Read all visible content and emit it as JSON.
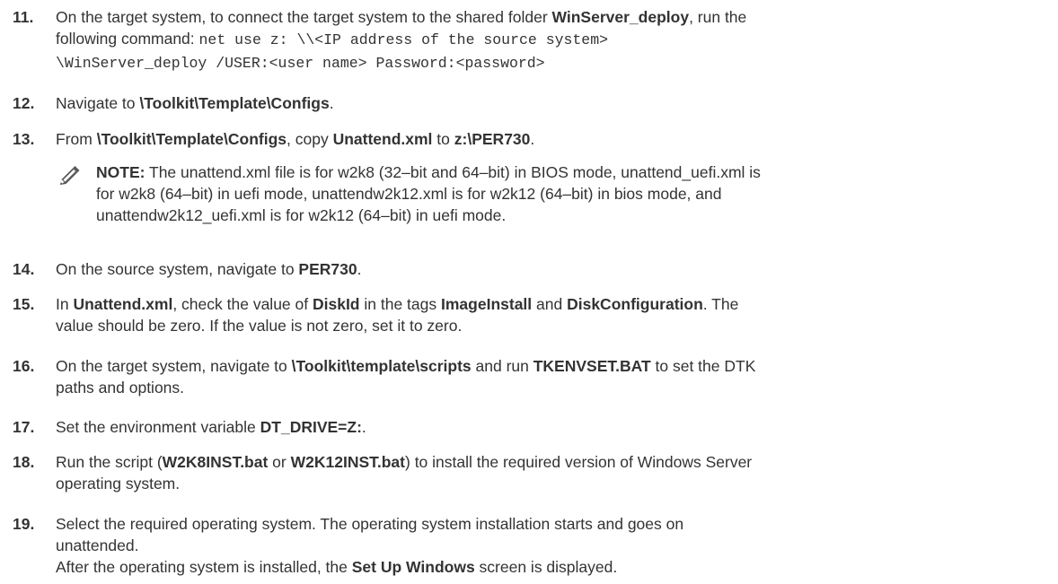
{
  "steps": [
    {
      "num": "11.",
      "lines": [
        [
          {
            "t": "On the target system, to connect the target system to the shared folder ",
            "s": ""
          },
          {
            "t": "WinServer_deploy",
            "s": "b"
          },
          {
            "t": ", run the",
            "s": ""
          }
        ],
        [
          {
            "t": "following command: ",
            "s": ""
          },
          {
            "t": "net use z: \\\\<IP address of the source system>",
            "s": "mono"
          }
        ],
        [
          {
            "t": "\\WinServer_deploy /USER:<user name> Password:<password>",
            "s": "mono"
          }
        ]
      ]
    },
    {
      "num": "12.",
      "lines": [
        [
          {
            "t": "Navigate to ",
            "s": ""
          },
          {
            "t": "\\Toolkit\\Template\\Configs",
            "s": "b"
          },
          {
            "t": ".",
            "s": ""
          }
        ]
      ]
    },
    {
      "num": "13.",
      "lines": [
        [
          {
            "t": "From ",
            "s": ""
          },
          {
            "t": "\\Toolkit\\Template\\Configs",
            "s": "b"
          },
          {
            "t": ", copy ",
            "s": ""
          },
          {
            "t": "Unattend.xml",
            "s": "b"
          },
          {
            "t": "  to ",
            "s": ""
          },
          {
            "t": "z:\\PER730",
            "s": "b"
          },
          {
            "t": ".",
            "s": ""
          }
        ]
      ]
    },
    {
      "num": "14.",
      "lines": [
        [
          {
            "t": "On the source system, navigate to ",
            "s": ""
          },
          {
            "t": "PER730",
            "s": "b"
          },
          {
            "t": ".",
            "s": ""
          }
        ]
      ]
    },
    {
      "num": "15.",
      "lines": [
        [
          {
            "t": "In ",
            "s": ""
          },
          {
            "t": "Unattend.xml",
            "s": "b"
          },
          {
            "t": ", check the value of  ",
            "s": ""
          },
          {
            "t": "DiskId",
            "s": "b"
          },
          {
            "t": " in the tags ",
            "s": ""
          },
          {
            "t": "ImageInstall",
            "s": "b"
          },
          {
            "t": " and ",
            "s": ""
          },
          {
            "t": "DiskConfiguration",
            "s": "b"
          },
          {
            "t": ". The",
            "s": ""
          }
        ],
        [
          {
            "t": "value should be zero. If the value is not zero, set it to zero.",
            "s": ""
          }
        ]
      ]
    },
    {
      "num": "16.",
      "lines": [
        [
          {
            "t": "On the target system, navigate to ",
            "s": ""
          },
          {
            "t": "\\Toolkit\\template\\scripts",
            "s": "b"
          },
          {
            "t": " and run ",
            "s": ""
          },
          {
            "t": "TKENVSET.BAT",
            "s": "b"
          },
          {
            "t": " to set the DTK",
            "s": ""
          }
        ],
        [
          {
            "t": "paths and options.",
            "s": ""
          }
        ]
      ]
    },
    {
      "num": "17.",
      "lines": [
        [
          {
            "t": "Set the environment variable ",
            "s": ""
          },
          {
            "t": "DT_DRIVE=Z:",
            "s": "b"
          },
          {
            "t": ".",
            "s": ""
          }
        ]
      ]
    },
    {
      "num": "18.",
      "lines": [
        [
          {
            "t": "Run the script (",
            "s": ""
          },
          {
            "t": "W2K8INST.bat",
            "s": "b"
          },
          {
            "t": " or ",
            "s": ""
          },
          {
            "t": "W2K12INST.bat",
            "s": "b"
          },
          {
            "t": ") to install the required version of Windows Server",
            "s": ""
          }
        ],
        [
          {
            "t": "operating system.",
            "s": ""
          }
        ]
      ]
    },
    {
      "num": "19.",
      "lines": [
        [
          {
            "t": "Select the required operating system. The operating system installation starts and goes on",
            "s": ""
          }
        ],
        [
          {
            "t": "unattended.",
            "s": ""
          }
        ]
      ]
    }
  ],
  "note": {
    "icon": "pencil-note-icon",
    "lines": [
      [
        {
          "t": "NOTE:",
          "s": "b"
        },
        {
          "t": " The unattend.xml file is for w2k8 (32–bit and 64–bit) in BIOS mode, unattend_uefi.xml is",
          "s": ""
        }
      ],
      [
        {
          "t": "for w2k8 (64–bit) in uefi mode, unattendw2k12.xml is for w2k12 (64–bit) in bios mode, and",
          "s": ""
        }
      ],
      [
        {
          "t": "unattendw2k12_uefi.xml is for w2k12 (64–bit) in uefi mode.",
          "s": ""
        }
      ]
    ]
  },
  "after_text": [
    {
      "t": "After the operating system is installed, the ",
      "s": ""
    },
    {
      "t": "Set Up Windows",
      "s": "b"
    },
    {
      "t": " screen is displayed.",
      "s": ""
    }
  ]
}
